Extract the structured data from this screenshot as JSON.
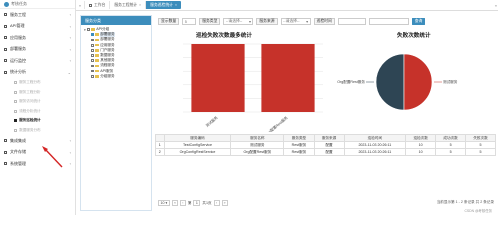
{
  "app": {
    "logo_text": "考核任务"
  },
  "sidebar": {
    "items": [
      {
        "label": "服务工程",
        "icon": "gear-icon",
        "chev": "‹"
      },
      {
        "label": "API管理",
        "icon": "api-icon",
        "chev": "‹"
      },
      {
        "label": "应用服务",
        "icon": "app-icon",
        "chev": "‹"
      },
      {
        "label": "部署服务",
        "icon": "deploy-icon",
        "chev": "‹"
      },
      {
        "label": "运行监控",
        "icon": "monitor-icon",
        "chev": "‹"
      },
      {
        "label": "统计分析",
        "icon": "stats-icon",
        "chev": "⌄"
      }
    ],
    "subitems": [
      {
        "label": "服务工程分布"
      },
      {
        "label": "服务工程分析"
      },
      {
        "label": "服务访问统计"
      },
      {
        "label": "流程分析统计"
      },
      {
        "label": "服务巡检统计",
        "active": true
      },
      {
        "label": "数据服务分布"
      }
    ],
    "bottom_items": [
      {
        "label": "集成集成",
        "icon": "integrate-icon",
        "chev": "‹"
      },
      {
        "label": "文件存储",
        "icon": "file-icon",
        "chev": "‹"
      },
      {
        "label": "系统管理",
        "icon": "system-icon",
        "chev": "‹"
      }
    ]
  },
  "tabs": [
    {
      "label": "工作台",
      "home": true
    },
    {
      "label": "服务工程统计"
    },
    {
      "label": "服务巡检统计",
      "active": true
    }
  ],
  "tree": {
    "title": "服务分类",
    "root": "API分组",
    "nodes": [
      {
        "label": "部署服务",
        "checked": true,
        "selected": true
      },
      {
        "label": "部署服务"
      },
      {
        "label": "应用服务"
      },
      {
        "label": "门户服务"
      },
      {
        "label": "数据服务"
      },
      {
        "label": "其他服务"
      },
      {
        "label": "流程服务"
      },
      {
        "label": "API服务"
      },
      {
        "label": "分组服务"
      }
    ]
  },
  "filters": {
    "count_label": "显示数量",
    "count_value": "5",
    "type_label": "服务类型",
    "type_value": "--请选择--",
    "source_label": "服务来源",
    "source_value": "--请选择--",
    "time_label": "巡检时间",
    "search_label": "查询"
  },
  "bar_title": "巡检失败次数最多统计",
  "pie_title": "失败次数统计",
  "chart_data": [
    {
      "type": "bar",
      "title": "巡检失败次数最多统计",
      "categories": [
        "测试服务",
        "Org配置Rest服务"
      ],
      "values": [
        5,
        5
      ],
      "ylim": [
        0,
        5
      ],
      "grid": true,
      "color": "#c6322a"
    },
    {
      "type": "pie",
      "title": "失败次数统计",
      "labels": [
        "Org配置Rest服务",
        "测试服务"
      ],
      "values": [
        5,
        5
      ],
      "colors": [
        "#2e4554",
        "#c6322a"
      ]
    }
  ],
  "table": {
    "headers": [
      "",
      "服务编码",
      "服务名称",
      "服务类型",
      "服务来源",
      "巡检时间",
      "巡检次数",
      "成功次数",
      "失败次数"
    ],
    "rows": [
      [
        "1",
        "TestConfigService",
        "测试服务",
        "Rest服务",
        "配置",
        "2023-11-03 20:26:11",
        "10",
        "5",
        "5"
      ],
      [
        "2",
        "OrgConfigRestService",
        "Org配置Rest服务",
        "Rest服务",
        "配置",
        "2023-11-03 20:26:11",
        "10",
        "5",
        "5"
      ]
    ]
  },
  "pager": {
    "page_size": "10",
    "first": "«",
    "prev": "‹",
    "page_prefix": "第",
    "page": "1",
    "page_suffix": "共1页",
    "next": "›",
    "last": "»",
    "summary": "当前显示第 1 - 2 条记录 共 2 条记录"
  },
  "watermark": "CSDN @考核任务"
}
